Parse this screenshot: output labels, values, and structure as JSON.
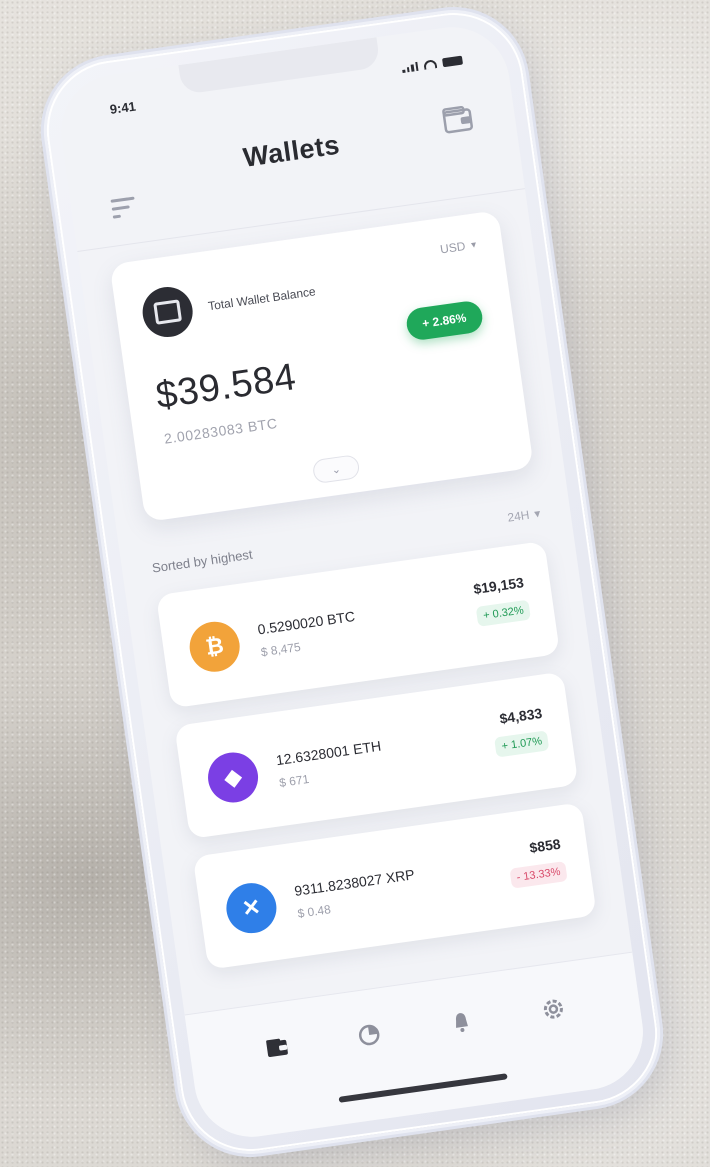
{
  "status_bar": {
    "time": "9:41"
  },
  "header": {
    "title": "Wallets"
  },
  "balance_card": {
    "label": "Total Wallet Balance",
    "currency": "USD",
    "change": "+ 2.86%",
    "amount": "$39.584",
    "btc_amount": "2.00283083 BTC"
  },
  "assets_section": {
    "title": "Sorted by highest",
    "sort_label": "24H"
  },
  "assets": [
    {
      "name": "BTC",
      "amount": "0.5290020 BTC",
      "sub": "$ 8,475",
      "value": "$19,153",
      "change": "+ 0.32%",
      "direction": "up",
      "color": "#f2a33a",
      "glyph": "₿"
    },
    {
      "name": "ETH",
      "amount": "12.6328001 ETH",
      "sub": "$ 671",
      "value": "$4,833",
      "change": "+ 1.07%",
      "direction": "up",
      "color": "#7b3fe4",
      "glyph": "◆"
    },
    {
      "name": "XRP",
      "amount": "9311.8238027 XRP",
      "sub": "$ 0.48",
      "value": "$858",
      "change": "- 13.33%",
      "direction": "down",
      "color": "#2f7fe8",
      "glyph": "✕"
    }
  ],
  "icons": {
    "wallet": "wallet-icon",
    "menu": "menu-icon",
    "tabs": [
      "wallet-icon",
      "chart-icon",
      "bell-icon",
      "gear-icon"
    ]
  }
}
